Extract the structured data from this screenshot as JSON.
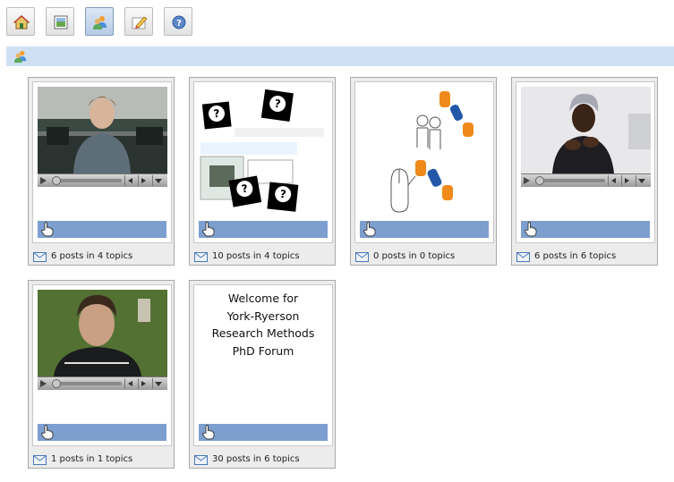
{
  "toolbar": {
    "buttons": [
      {
        "name": "home-icon",
        "active": false
      },
      {
        "name": "picture-icon",
        "active": false
      },
      {
        "name": "users-icon",
        "active": true
      },
      {
        "name": "edit-icon",
        "active": false
      },
      {
        "name": "help-icon",
        "active": false
      }
    ]
  },
  "section": {
    "icon": "users-icon"
  },
  "forums": [
    {
      "media": "video",
      "stats": "6 posts in 4 topics"
    },
    {
      "media": "image",
      "stats": "10 posts in 4 topics"
    },
    {
      "media": "image",
      "stats": "0 posts in 0 topics"
    },
    {
      "media": "video",
      "stats": "6 posts in 6 topics"
    },
    {
      "media": "video",
      "stats": "1 posts in 1 topics"
    },
    {
      "media": "text",
      "stats": "30 posts in 6 topics",
      "welcome_lines": [
        "Welcome for",
        "York-Ryerson",
        "Research Methods",
        "PhD Forum"
      ]
    }
  ],
  "colors": {
    "section_bar": "#cfe0f4",
    "open_bar": "#7d9fcf",
    "accent_button": "#b7cbe6"
  }
}
